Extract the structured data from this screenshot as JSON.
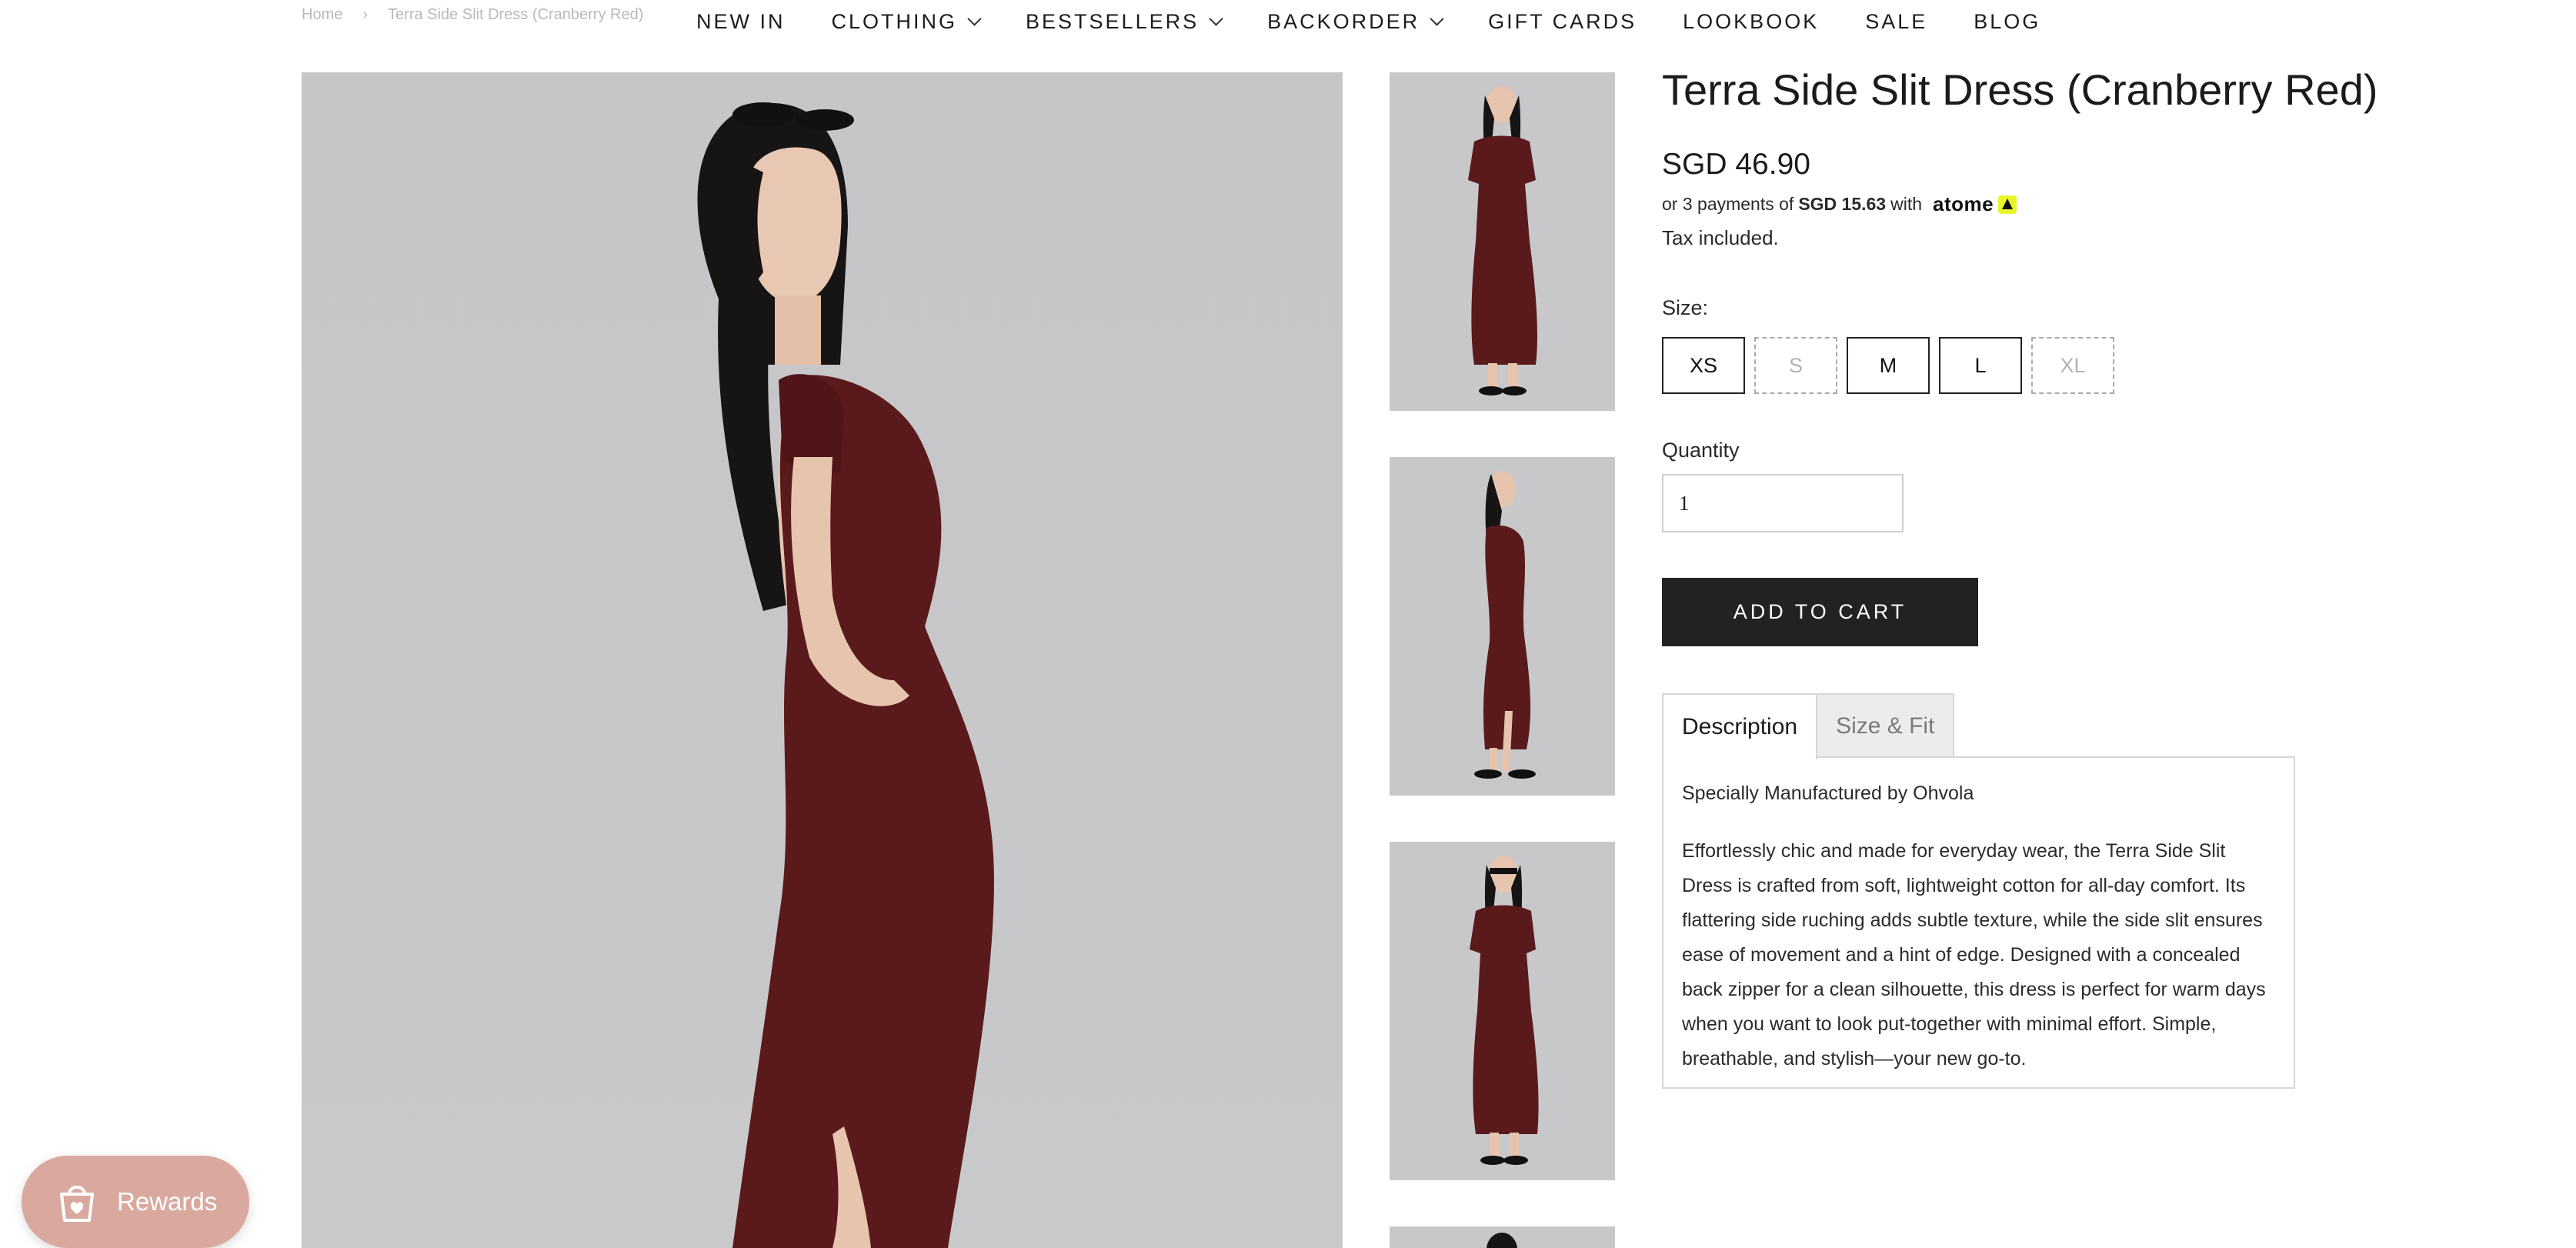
{
  "breadcrumb": {
    "home": "Home",
    "separator": "›",
    "current": "Terra Side Slit Dress (Cranberry Red)"
  },
  "nav": [
    {
      "label": "NEW IN",
      "has_dropdown": false
    },
    {
      "label": "CLOTHING",
      "has_dropdown": true
    },
    {
      "label": "BESTSELLERS",
      "has_dropdown": true
    },
    {
      "label": "BACKORDER",
      "has_dropdown": true
    },
    {
      "label": "GIFT CARDS",
      "has_dropdown": false
    },
    {
      "label": "LOOKBOOK",
      "has_dropdown": false
    },
    {
      "label": "SALE",
      "has_dropdown": false
    },
    {
      "label": "BLOG",
      "has_dropdown": false
    }
  ],
  "product": {
    "title": "Terra Side Slit Dress (Cranberry Red)",
    "price": "SGD 46.90",
    "installment": {
      "prefix": "or 3 payments of",
      "amount": "SGD 15.63",
      "suffix": "with",
      "provider": "atome"
    },
    "tax_note": "Tax included.",
    "size_label": "Size:",
    "sizes": [
      {
        "label": "XS",
        "available": true
      },
      {
        "label": "S",
        "available": false
      },
      {
        "label": "M",
        "available": true
      },
      {
        "label": "L",
        "available": true
      },
      {
        "label": "XL",
        "available": false
      }
    ],
    "quantity_label": "Quantity",
    "quantity": "1",
    "add_to_cart": "ADD TO CART",
    "tabs": [
      {
        "label": "Description",
        "active": true
      },
      {
        "label": "Size & Fit",
        "active": false
      }
    ],
    "description": {
      "heading": "Specially Manufactured by Ohvola",
      "body": "Effortlessly chic and made for everyday wear, the Terra Side Slit Dress is crafted from soft, lightweight cotton for all-day comfort. Its flattering side ruching adds subtle texture, while the side slit ensures ease of movement and a hint of edge. Designed with a concealed back zipper for a clean silhouette, this dress is perfect for warm days when you want to look put-together with minimal effort. Simple, breathable, and stylish—your new go-to."
    }
  },
  "rewards": {
    "label": "Rewards",
    "icon": "shopping-bag-heart-icon"
  },
  "colors": {
    "dress": "#5a1a1c",
    "photo_bg": "#c7c7c9",
    "button_dark": "#222222",
    "rewards_bg": "#d9a9a0",
    "atome_yellow": "#e8f52a"
  }
}
